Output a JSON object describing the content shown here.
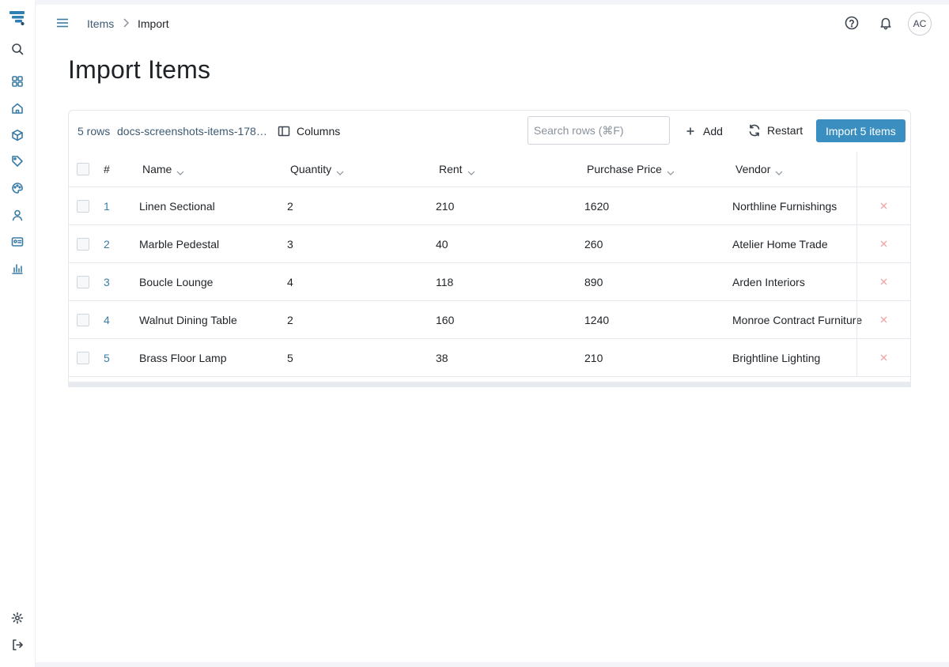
{
  "sidebar": {
    "icons": [
      "logo-icon",
      "search-icon",
      "dashboard-icon",
      "home-icon",
      "box-icon",
      "tag-icon",
      "palette-icon",
      "user-icon",
      "id-card-icon",
      "chart-icon",
      "settings-icon",
      "logout-icon"
    ]
  },
  "breadcrumb": {
    "items_label": "Items",
    "current_label": "Import"
  },
  "header": {
    "avatar_initials": "AC"
  },
  "page": {
    "title": "Import Items"
  },
  "toolbar": {
    "row_count": "5 rows",
    "file_name": "docs-screenshots-items-178…",
    "columns_label": "Columns",
    "search_placeholder": "Search rows (⌘F)",
    "add_label": "Add",
    "restart_label": "Restart",
    "import_label": "Import 5 items"
  },
  "table": {
    "columns": {
      "index": "#",
      "name": "Name",
      "quantity": "Quantity",
      "rent": "Rent",
      "purchase_price": "Purchase Price",
      "vendor": "Vendor"
    },
    "rows": [
      {
        "index": "1",
        "name": "Linen Sectional",
        "quantity": "2",
        "rent": "210",
        "purchase_price": "1620",
        "vendor": "Northline Furnishings"
      },
      {
        "index": "2",
        "name": "Marble Pedestal",
        "quantity": "3",
        "rent": "40",
        "purchase_price": "260",
        "vendor": "Atelier Home Trade"
      },
      {
        "index": "3",
        "name": "Boucle Lounge",
        "quantity": "4",
        "rent": "118",
        "purchase_price": "890",
        "vendor": "Arden Interiors"
      },
      {
        "index": "4",
        "name": "Walnut Dining Table",
        "quantity": "2",
        "rent": "160",
        "purchase_price": "1240",
        "vendor": "Monroe Contract Furniture"
      },
      {
        "index": "5",
        "name": "Brass Floor Lamp",
        "quantity": "5",
        "rent": "38",
        "purchase_price": "210",
        "vendor": "Brightline Lighting"
      }
    ]
  },
  "colors": {
    "accent": "#3a8fc0",
    "link": "#3a7ca5",
    "delete": "#f0a9a4"
  }
}
